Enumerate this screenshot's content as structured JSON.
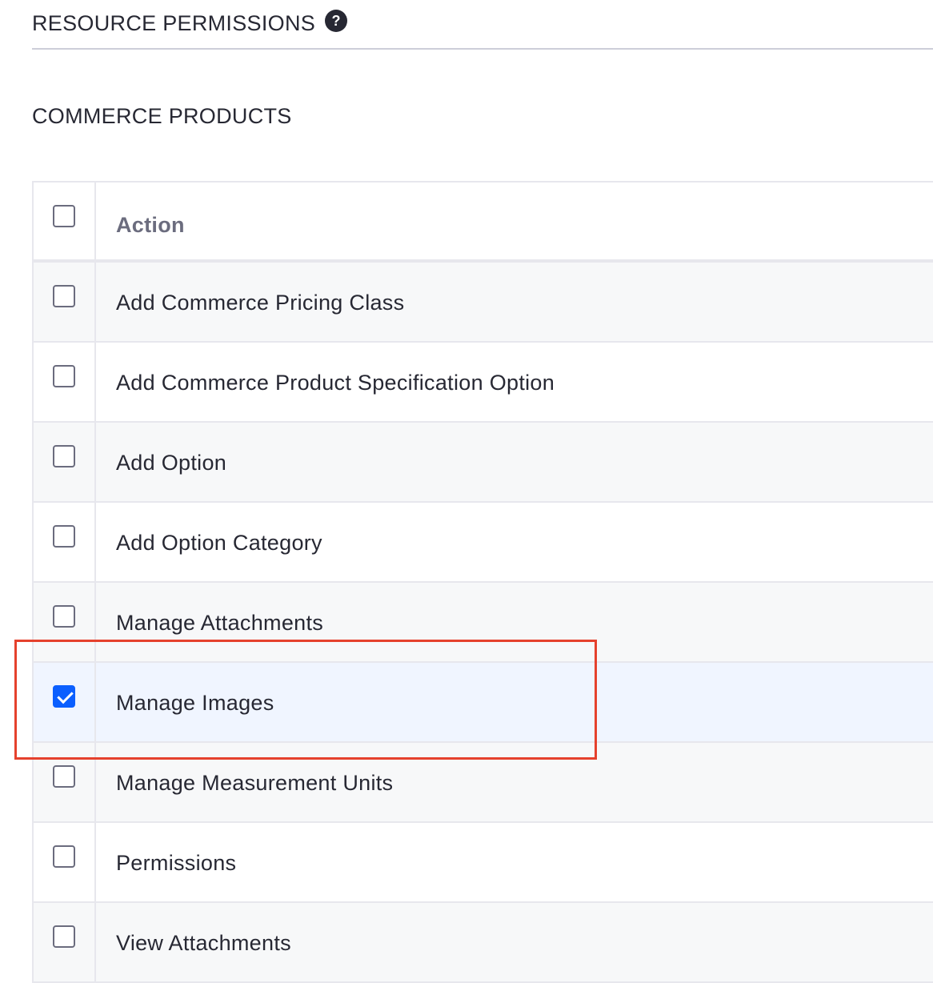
{
  "section": {
    "title": "RESOURCE PERMISSIONS",
    "help_icon": "question-circle-icon"
  },
  "resource": {
    "title": "COMMERCE PRODUCTS"
  },
  "table": {
    "header": {
      "label": "Action",
      "checked": false
    },
    "rows": [
      {
        "label": "Add Commerce Pricing Class",
        "checked": false
      },
      {
        "label": "Add Commerce Product Specification Option",
        "checked": false
      },
      {
        "label": "Add Option",
        "checked": false
      },
      {
        "label": "Add Option Category",
        "checked": false
      },
      {
        "label": "Manage Attachments",
        "checked": false
      },
      {
        "label": "Manage Images",
        "checked": true
      },
      {
        "label": "Manage Measurement Units",
        "checked": false
      },
      {
        "label": "Permissions",
        "checked": false
      },
      {
        "label": "View Attachments",
        "checked": false
      }
    ]
  },
  "colors": {
    "checkbox_checked": "#0b5fff",
    "highlight_box": "#e5412d"
  }
}
